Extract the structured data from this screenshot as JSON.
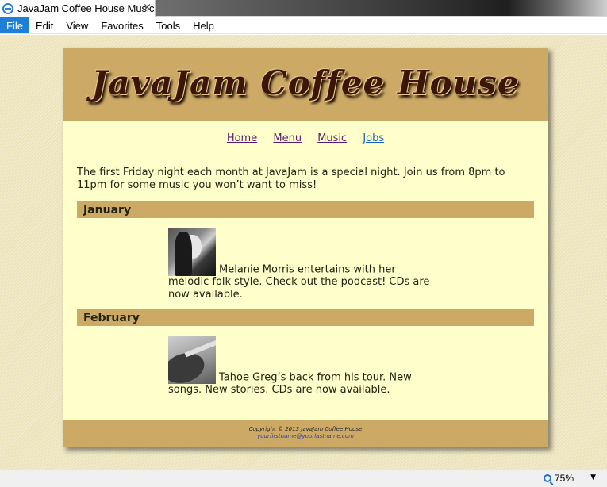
{
  "browser": {
    "tab_title": "JavaJam Coffee House Music",
    "tab_close_glyph": "×",
    "menu": [
      "File",
      "Edit",
      "View",
      "Favorites",
      "Tools",
      "Help"
    ],
    "active_menu": "File",
    "zoom": "75%",
    "zoom_dropdown_glyph": "▼"
  },
  "site": {
    "logo": "JavaJam Coffee House",
    "nav": [
      "Home",
      "Menu",
      "Music",
      "Jobs"
    ],
    "intro": "The first Friday night each month at JavaJam is a special night. Join us from 8pm to 11pm for some music you won’t want to miss!",
    "months": [
      {
        "name": "January",
        "image": "melanie-morris-photo",
        "text": "Melanie Morris entertains with her melodic folk style. Check out the podcast! CDs are now available."
      },
      {
        "name": "February",
        "image": "tahoe-greg-guitar-photo",
        "text": "Tahoe Greg’s back from his tour. New songs. New stories. CDs are now available."
      }
    ],
    "footer": {
      "copyright": "Copyright © 2013 JavaJam Coffee House",
      "email": "yourfirstname@yourlastname.com"
    }
  },
  "colors": {
    "header_bg": "#ccaa66",
    "content_bg": "#ffffcc",
    "active_menu_bg": "#1e7fd6",
    "link_color": "#5e1b6b"
  }
}
